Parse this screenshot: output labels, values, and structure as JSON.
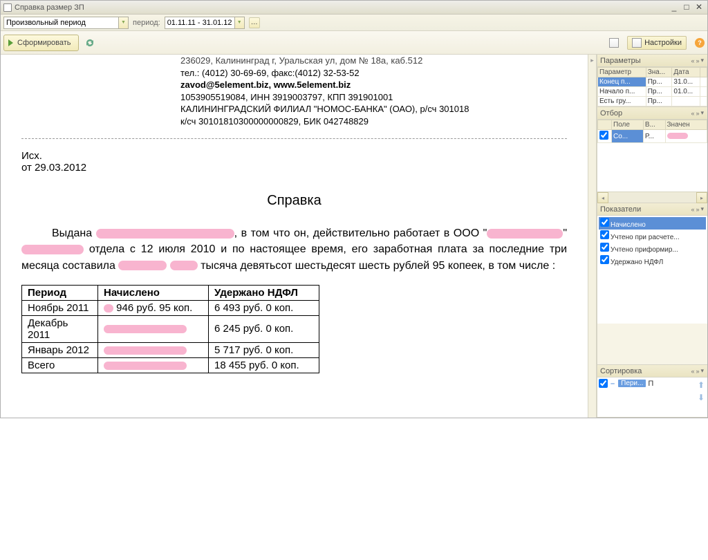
{
  "title": "Справка размер ЗП",
  "toolbar": {
    "period_type": "Произвольный период",
    "period_label": "период:",
    "period_value": "01.11.11 - 31.01.12",
    "form_button": "Сформировать",
    "settings": "Настройки"
  },
  "document": {
    "addr1": "236029, Калининград г, Уральская ул, дом № 18а, каб.512",
    "addr2": "тел.: (4012) 30-69-69, факс:(4012) 32-53-52",
    "email": "zavod@5element.biz, www.5element.biz",
    "reg": "1053905519084, ИНН 3919003797, КПП 391901001",
    "bank1": "КАЛИНИНГРАДСКИЙ ФИЛИАЛ \"НОМОС-БАНКА\" (ОАО), р/сч 301018",
    "bank2": "к/сч 30101810300000000829, БИК 042748829",
    "ish": "Исх.",
    "date": "от 29.03.2012",
    "doc_title": "Справка",
    "body_pre": "Выдана ",
    "body_mid1": ", в том что он, действительно работает в ООО \"",
    "body_mid2": "\" ",
    "body_mid3": " отдела с 12 июля 2010 и по настоящее время, его заработная плата за последние три месяца составила ",
    "body_end": " тысяча девятьсот шестьдесят шесть рублей 95 копеек, в том числе :",
    "table": {
      "headers": [
        "Период",
        "Начислено",
        "Удержано НДФЛ"
      ],
      "rows": [
        {
          "period": "Ноябрь 2011",
          "accrued_suffix": " 946 руб.  95 коп.",
          "tax": "6 493 руб.  0 коп."
        },
        {
          "period": "Декабрь 2011",
          "accrued_suffix": "",
          "tax": "6 245 руб.  0 коп."
        },
        {
          "period": "Январь 2012",
          "accrued_suffix": "",
          "tax": "5 717 руб.  0 коп."
        },
        {
          "period": "Всего",
          "accrued_suffix": "",
          "tax": "18 455 руб. 0 коп."
        }
      ]
    }
  },
  "panels": {
    "params": {
      "title": "Параметры",
      "cols": [
        "Параметр",
        "Зна...",
        "Дата"
      ],
      "rows": [
        {
          "p": "Конец п...",
          "v": "Пр...",
          "d": "31.0..."
        },
        {
          "p": "Начало п...",
          "v": "Пр...",
          "d": "01.0..."
        },
        {
          "p": "Есть гру...",
          "v": "Пр...",
          "d": ""
        }
      ]
    },
    "filter": {
      "title": "Отбор",
      "cols": [
        "",
        "Поле",
        "В...",
        "Значен"
      ],
      "row": {
        "field": "Со...",
        "v": "Р...",
        "val": ""
      }
    },
    "indicators": {
      "title": "Показатели",
      "items": [
        "Начислено",
        "Учтено при расчете...",
        "Учтено приформир...",
        "Удержано НДФЛ"
      ]
    },
    "sort": {
      "title": "Сортировка",
      "item": "Пери...",
      "dir": "П"
    }
  }
}
